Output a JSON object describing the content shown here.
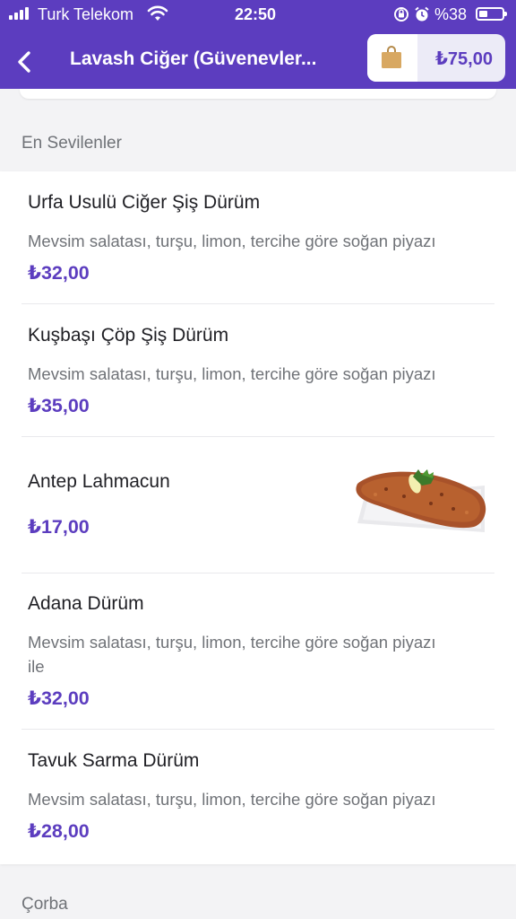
{
  "status_bar": {
    "carrier": "Turk Telekom",
    "time": "22:50",
    "battery_text": "%38",
    "battery_level": 0.38
  },
  "header": {
    "title": "Lavash Ciğer (Güvenevler...",
    "cart_total": "₺75,00",
    "color": "#5c3dbf"
  },
  "sections": [
    {
      "title": "En Sevilenler",
      "items": [
        {
          "name": "Urfa Usulü Ciğer Şiş Dürüm",
          "description": "Mevsim salatası, turşu, limon, tercihe göre soğan piyazı",
          "price": "₺32,00"
        },
        {
          "name": "Kuşbaşı Çöp Şiş Dürüm",
          "description": "Mevsim salatası, turşu, limon, tercihe göre soğan piyazı",
          "price": "₺35,00"
        },
        {
          "name": "Antep Lahmacun",
          "description": "",
          "price": "₺17,00",
          "image": "lahmacun-photo"
        },
        {
          "name": "Adana Dürüm",
          "description": "Mevsim salatası, turşu, limon, tercihe göre soğan piyazı ile",
          "price": "₺32,00"
        },
        {
          "name": "Tavuk Sarma Dürüm",
          "description": "Mevsim salatası, turşu, limon, tercihe göre soğan piyazı",
          "price": "₺28,00"
        }
      ]
    },
    {
      "title": "Çorba"
    }
  ],
  "icons": {
    "back": "chevron-left-icon",
    "cart": "shopping-bag-icon",
    "signal": "cellular-signal-icon",
    "wifi": "wifi-icon",
    "rotation_lock": "rotation-lock-icon",
    "alarm": "alarm-clock-icon",
    "battery": "battery-icon"
  }
}
